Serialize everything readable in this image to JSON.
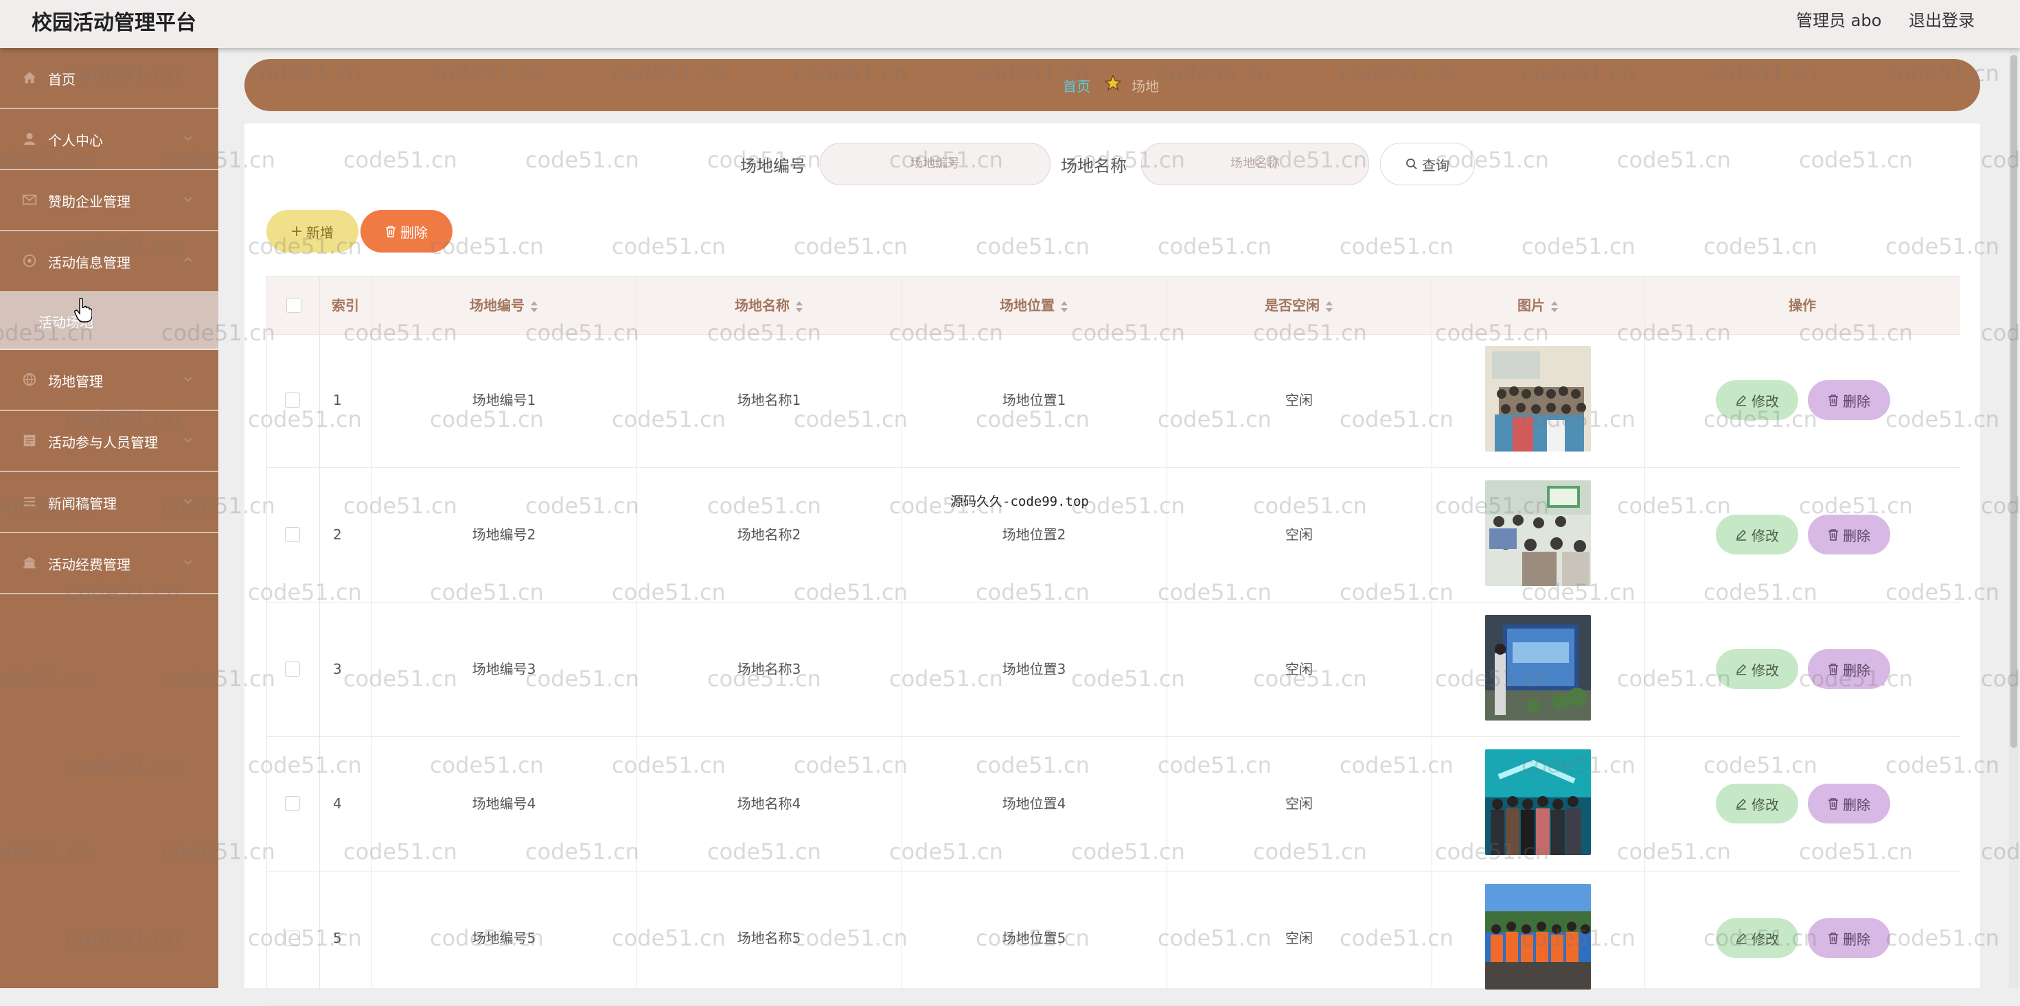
{
  "header": {
    "title": "校园活动管理平台",
    "user": "管理员 abo",
    "logout": "退出登录"
  },
  "sidebar": {
    "items": [
      {
        "label": "首页",
        "icon": "home-icon"
      },
      {
        "label": "个人中心",
        "icon": "user-icon"
      },
      {
        "label": "赞助企业管理",
        "icon": "mail-icon"
      },
      {
        "label": "活动信息管理",
        "icon": "settings-icon"
      },
      {
        "label": "场地管理",
        "icon": "globe-icon"
      },
      {
        "label": "活动参与人员管理",
        "icon": "card-icon"
      },
      {
        "label": "新闻稿管理",
        "icon": "list-icon"
      },
      {
        "label": "活动经费管理",
        "icon": "bank-icon"
      }
    ],
    "submenu": {
      "label": "活动场地"
    }
  },
  "breadcrumb": {
    "home": "首页",
    "current": "场地"
  },
  "search": {
    "code_label": "场地编号",
    "code_placeholder": "场地编号",
    "name_label": "场地名称",
    "name_placeholder": "场地名称",
    "query_button": "查询"
  },
  "toolbar": {
    "add_label": "新增",
    "delete_label": "删除"
  },
  "table": {
    "columns": [
      "索引",
      "场地编号",
      "场地名称",
      "场地位置",
      "是否空闲",
      "图片",
      "操作"
    ],
    "rows": [
      {
        "index": "1",
        "code": "场地编号1",
        "name": "场地名称1",
        "location": "场地位置1",
        "free": "空闲"
      },
      {
        "index": "2",
        "code": "场地编号2",
        "name": "场地名称2",
        "location": "场地位置2",
        "free": "空闲"
      },
      {
        "index": "3",
        "code": "场地编号3",
        "name": "场地名称3",
        "location": "场地位置3",
        "free": "空闲"
      },
      {
        "index": "4",
        "code": "场地编号4",
        "name": "场地名称4",
        "location": "场地位置4",
        "free": "空闲"
      },
      {
        "index": "5",
        "code": "场地编号5",
        "name": "场地名称5",
        "location": "场地位置5",
        "free": "空闲"
      }
    ],
    "edit_label": "修改",
    "delete_label": "删除"
  },
  "watermark": {
    "text": "code51.cn",
    "center_text": "源码久久-code99.top"
  },
  "colors": {
    "sidebar": "#a5704f",
    "breadcrumb_bar": "#a8724f",
    "add_button": "#f0e08a",
    "delete_button": "#f07a44",
    "edit_button": "#c7e8c6",
    "row_delete_button": "#d8b8e4"
  }
}
